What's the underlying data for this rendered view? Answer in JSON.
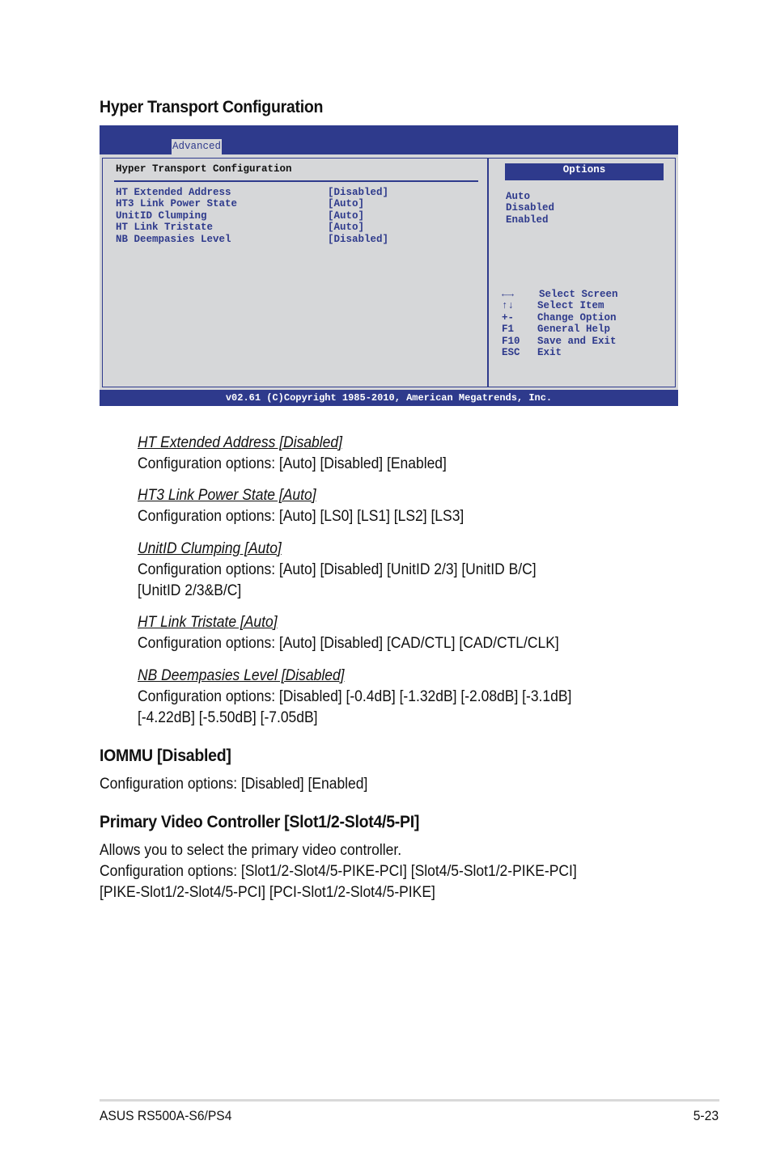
{
  "page": {
    "section_title": "Hyper Transport Configuration"
  },
  "bios": {
    "active_tab": "Advanced",
    "panel_heading": "Hyper Transport Configuration",
    "items": [
      {
        "label": "HT Extended Address",
        "value": "[Disabled]"
      },
      {
        "label": "HT3 Link Power State",
        "value": "[Auto]"
      },
      {
        "label": "UnitID Clumping",
        "value": "[Auto]"
      },
      {
        "label": "HT Link Tristate",
        "value": "[Auto]"
      },
      {
        "label": "NB Deempasies Level",
        "value": "[Disabled]"
      }
    ],
    "options_header": "Options",
    "options": [
      "Auto",
      "Disabled",
      "Enabled"
    ],
    "keys": [
      {
        "key": "←→",
        "desc": "Select Screen"
      },
      {
        "key": "↑↓",
        "desc": "Select Item"
      },
      {
        "key": "+-",
        "desc": "Change Option"
      },
      {
        "key": "F1",
        "desc": "General Help"
      },
      {
        "key": "F10",
        "desc": "Save and Exit"
      },
      {
        "key": "ESC",
        "desc": "Exit"
      }
    ],
    "footer": "v02.61 (C)Copyright 1985-2010, American Megatrends, Inc.",
    "colors": {
      "primary": "#2e3a8c",
      "background": "#d6d7d9"
    }
  },
  "descriptions": [
    {
      "title": "HT Extended Address [Disabled]",
      "lines": [
        "Configuration options: [Auto] [Disabled] [Enabled]"
      ]
    },
    {
      "title": "HT3 Link Power State [Auto]",
      "lines": [
        "Configuration options: [Auto] [LS0] [LS1] [LS2] [LS3]"
      ]
    },
    {
      "title": "UnitID Clumping [Auto]",
      "lines": [
        "Configuration options: [Auto] [Disabled] [UnitID 2/3] [UnitID B/C]",
        "[UnitID 2/3&B/C]"
      ]
    },
    {
      "title": "HT Link Tristate [Auto]",
      "lines": [
        "Configuration options: [Auto] [Disabled] [CAD/CTL] [CAD/CTL/CLK]"
      ]
    },
    {
      "title": "NB Deempasies Level [Disabled]",
      "lines": [
        "Configuration options: [Disabled] [-0.4dB] [-1.32dB] [-2.08dB] [-3.1dB]",
        "[-4.22dB] [-5.50dB] [-7.05dB]"
      ]
    }
  ],
  "iommu": {
    "title": "IOMMU [Disabled]",
    "text": "Configuration options: [Disabled] [Enabled]"
  },
  "video": {
    "title": "Primary Video Controller [Slot1/2-Slot4/5-PI]",
    "lines": [
      "Allows you to select the primary video controller.",
      "Configuration options: [Slot1/2-Slot4/5-PIKE-PCI] [Slot4/5-Slot1/2-PIKE-PCI]",
      "[PIKE-Slot1/2-Slot4/5-PCI] [PCI-Slot1/2-Slot4/5-PIKE]"
    ]
  },
  "footer": {
    "model": "ASUS RS500A-S6/PS4",
    "page_number": "5-23"
  }
}
